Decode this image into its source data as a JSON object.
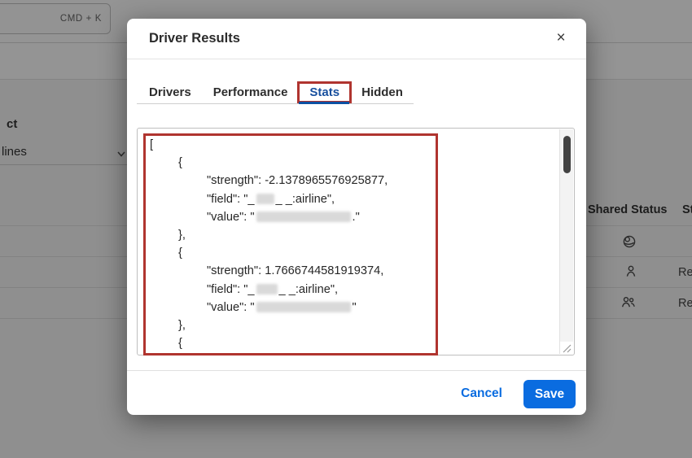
{
  "background": {
    "shortcut_badge": "CMD + K",
    "left_label_truncated": "ct",
    "dropdown_value_truncated": "lines",
    "table": {
      "columns": [
        "Shared Status",
        "St"
      ],
      "rows": [
        {
          "shared_icon": "globe-icon",
          "status_truncated": ""
        },
        {
          "shared_icon": "person-icon",
          "status_truncated": "Re"
        },
        {
          "shared_icon": "people-icon",
          "status_truncated": "Re"
        }
      ]
    }
  },
  "modal": {
    "title": "Driver Results",
    "close_label": "×",
    "tabs": [
      {
        "label": "Drivers"
      },
      {
        "label": "Performance"
      },
      {
        "label": "Stats"
      },
      {
        "label": "Hidden"
      }
    ],
    "active_tab": "Stats",
    "editor": {
      "lines": [
        {
          "indent": 0,
          "segments": [
            {
              "t": "["
            }
          ]
        },
        {
          "indent": 1,
          "segments": [
            {
              "t": "{"
            }
          ]
        },
        {
          "indent": 2,
          "segments": [
            {
              "t": "\"strength\": -2.1378965576925877,"
            }
          ]
        },
        {
          "indent": 2,
          "segments": [
            {
              "t": "\"field\": \"_"
            },
            {
              "blur": 22
            },
            {
              "t": "_ _:airline\","
            }
          ]
        },
        {
          "indent": 2,
          "segments": [
            {
              "t": "\"value\": \""
            },
            {
              "blur": 116
            },
            {
              "t": ".\""
            }
          ]
        },
        {
          "indent": 1,
          "segments": [
            {
              "t": "},"
            }
          ]
        },
        {
          "indent": 1,
          "segments": [
            {
              "t": "{"
            }
          ]
        },
        {
          "indent": 2,
          "segments": [
            {
              "t": "\"strength\": 1.7666744581919374,"
            }
          ]
        },
        {
          "indent": 2,
          "segments": [
            {
              "t": "\"field\": \"_"
            },
            {
              "blur": 26
            },
            {
              "t": "_ _:airline\","
            }
          ]
        },
        {
          "indent": 2,
          "segments": [
            {
              "t": "\"value\": \""
            },
            {
              "blur": 116
            },
            {
              "t": "\""
            }
          ]
        },
        {
          "indent": 1,
          "segments": [
            {
              "t": "},"
            }
          ]
        },
        {
          "indent": 1,
          "segments": [
            {
              "t": "{"
            }
          ]
        }
      ]
    },
    "footer": {
      "cancel_label": "Cancel",
      "save_label": "Save"
    }
  },
  "colors": {
    "accent_blue": "#0a6ce0",
    "active_tab_blue": "#174f9e",
    "annotation_red": "#b0342f",
    "overlay": "rgba(0,0,0,0.42)"
  }
}
